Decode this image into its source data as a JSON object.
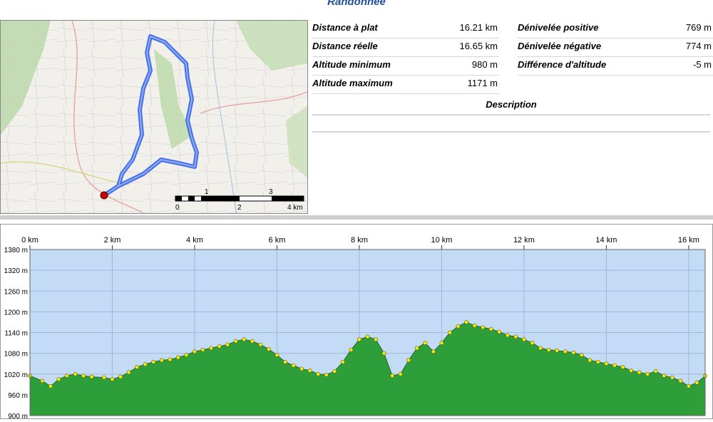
{
  "title": "Randonnée",
  "stats_left": [
    {
      "label": "Distance à plat",
      "value": "16.21 km"
    },
    {
      "label": "Distance réelle",
      "value": "16.65 km"
    },
    {
      "label": "Altitude minimum",
      "value": "980 m"
    },
    {
      "label": "Altitude maximum",
      "value": "1171 m"
    }
  ],
  "stats_right": [
    {
      "label": "Dénivelée positive",
      "value": "769 m"
    },
    {
      "label": "Dénivelée négative",
      "value": "774 m"
    },
    {
      "label": "Différence d'altitude",
      "value": "-5 m"
    }
  ],
  "description_label": "Description",
  "map": {
    "scale_top_labels": [
      "1",
      "3"
    ],
    "scale_bottom_labels": [
      "0",
      "2",
      "4 km"
    ]
  },
  "chart_data": {
    "type": "area",
    "x_unit": "km",
    "y_unit": "m",
    "x_ticks": [
      "0 km",
      "2 km",
      "4 km",
      "6 km",
      "8 km",
      "10 km",
      "12 km",
      "14 km",
      "16 km"
    ],
    "y_ticks": [
      "1380 m",
      "1320 m",
      "1260 m",
      "1200 m",
      "1140 m",
      "1080 m",
      "1020 m",
      "960 m",
      "900 m"
    ],
    "xlim": [
      0,
      16.4
    ],
    "ylim": [
      900,
      1380
    ],
    "grid": true,
    "colors": {
      "fill": "#2e9e3a",
      "sky": "#c4dbf6",
      "point": "#f2ea1a"
    },
    "x": [
      0,
      0.3,
      0.5,
      0.7,
      0.9,
      1.1,
      1.3,
      1.5,
      1.8,
      2.0,
      2.2,
      2.4,
      2.6,
      2.8,
      3.0,
      3.2,
      3.4,
      3.6,
      3.8,
      4.0,
      4.2,
      4.4,
      4.6,
      4.8,
      5.0,
      5.2,
      5.4,
      5.6,
      5.8,
      6.0,
      6.2,
      6.4,
      6.6,
      6.8,
      7.0,
      7.2,
      7.4,
      7.6,
      7.8,
      8.0,
      8.2,
      8.4,
      8.6,
      8.8,
      9.0,
      9.2,
      9.4,
      9.6,
      9.8,
      10.0,
      10.2,
      10.4,
      10.6,
      10.8,
      11.0,
      11.2,
      11.4,
      11.6,
      11.8,
      12.0,
      12.2,
      12.4,
      12.6,
      12.8,
      13.0,
      13.2,
      13.4,
      13.6,
      13.8,
      14.0,
      14.2,
      14.4,
      14.6,
      14.8,
      15.0,
      15.2,
      15.4,
      15.6,
      15.8,
      16.0,
      16.2,
      16.4
    ],
    "y": [
      1015,
      1000,
      985,
      1005,
      1015,
      1020,
      1015,
      1012,
      1010,
      1005,
      1012,
      1025,
      1040,
      1048,
      1055,
      1060,
      1062,
      1068,
      1075,
      1085,
      1090,
      1095,
      1100,
      1105,
      1115,
      1120,
      1115,
      1105,
      1092,
      1075,
      1055,
      1045,
      1035,
      1030,
      1020,
      1018,
      1028,
      1055,
      1090,
      1120,
      1128,
      1120,
      1080,
      1015,
      1020,
      1060,
      1095,
      1110,
      1085,
      1110,
      1140,
      1158,
      1170,
      1160,
      1155,
      1150,
      1142,
      1132,
      1128,
      1120,
      1110,
      1095,
      1090,
      1088,
      1085,
      1082,
      1075,
      1060,
      1055,
      1050,
      1045,
      1040,
      1030,
      1025,
      1020,
      1028,
      1015,
      1010,
      1000,
      985,
      995,
      1015
    ]
  }
}
